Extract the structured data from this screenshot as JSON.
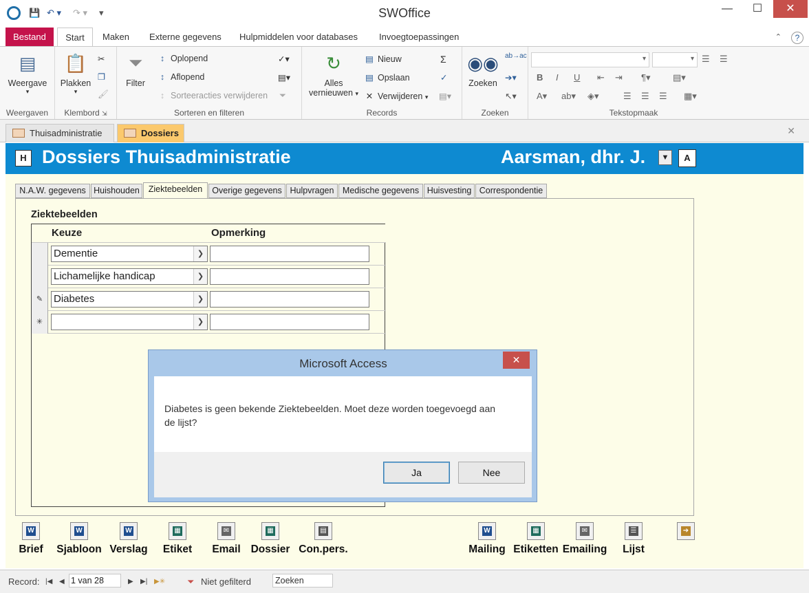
{
  "window": {
    "title": "SWOffice",
    "minimize": "—",
    "maximize": "☐",
    "close": "✕"
  },
  "ribbon_tabs": [
    "Bestand",
    "Start",
    "Maken",
    "Externe gegevens",
    "Hulpmiddelen voor databases",
    "Invoegtoepassingen"
  ],
  "ribbon": {
    "weergaven": {
      "button": "Weergave",
      "group": "Weergaven"
    },
    "klembord": {
      "button": "Plakken",
      "group": "Klembord"
    },
    "sorteren": {
      "filter": "Filter",
      "oplopend": "Oplopend",
      "aflopend": "Aflopend",
      "verwijderen": "Sorteeracties verwijderen",
      "group": "Sorteren en filteren"
    },
    "records": {
      "alles": "Alles",
      "vernieuwen": "vernieuwen",
      "nieuw": "Nieuw",
      "opslaan": "Opslaan",
      "verwijderen": "Verwijderen",
      "sum": "Σ",
      "group": "Records"
    },
    "zoeken": {
      "button": "Zoeken",
      "group": "Zoeken"
    },
    "tekstopmaak": {
      "group": "Tekstopmaak"
    }
  },
  "doc_tabs": [
    "Thuisadministratie",
    "Dossiers"
  ],
  "form": {
    "h_button": "H",
    "title": "Dossiers Thuisadministratie",
    "client": "Aarsman, dhr. J.",
    "a_button": "A",
    "page_tabs": [
      "N.A.W. gegevens",
      "Huishouden",
      "Ziektebeelden",
      "Overige gegevens",
      "Hulpvragen",
      "Medische gegevens",
      "Huisvesting",
      "Correspondentie"
    ],
    "active_tab": "Ziektebeelden",
    "section_title": "Ziektebeelden",
    "col_keuze": "Keuze",
    "col_opmerking": "Opmerking",
    "rows": [
      {
        "selector": "",
        "keuze": "Dementie",
        "opmerking": ""
      },
      {
        "selector": "",
        "keuze": "Lichamelijke handicap",
        "opmerking": ""
      },
      {
        "selector": "✎",
        "keuze": "Diabetes",
        "opmerking": ""
      },
      {
        "selector": "✳",
        "keuze": "",
        "opmerking": ""
      }
    ]
  },
  "bottom_buttons": [
    {
      "label": "Brief",
      "icon": "word-icon"
    },
    {
      "label": "Sjabloon",
      "icon": "word-icon"
    },
    {
      "label": "Verslag",
      "icon": "word-icon"
    },
    {
      "label": "Etiket",
      "icon": "label-icon"
    },
    {
      "label": "Email",
      "icon": "email-icon"
    },
    {
      "label": "Dossier",
      "icon": "dossier-icon"
    },
    {
      "label": "Con.pers.",
      "icon": "contact-icon"
    },
    {
      "label": "Mailing",
      "icon": "word-icon"
    },
    {
      "label": "Etiketten",
      "icon": "labels-icon"
    },
    {
      "label": "Emailing",
      "icon": "emailing-icon"
    },
    {
      "label": "Lijst",
      "icon": "list-icon"
    }
  ],
  "status": {
    "record_label": "Record:",
    "record_value": "1 van 28",
    "filter": "Niet gefilterd",
    "search": "Zoeken"
  },
  "dialog": {
    "title": "Microsoft Access",
    "message": "Diabetes is geen bekende Ziektebeelden. Moet deze worden toegevoegd aan de lijst?",
    "yes": "Ja",
    "no": "Nee"
  }
}
